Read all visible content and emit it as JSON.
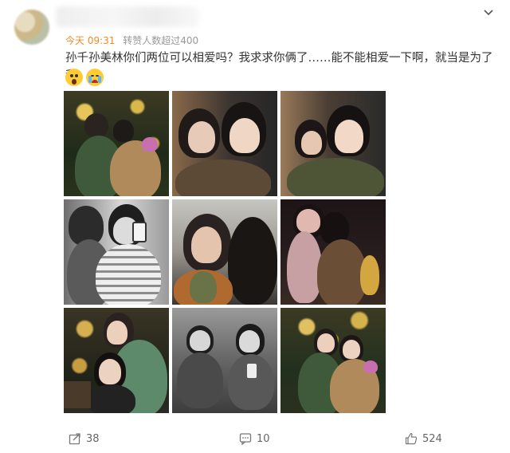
{
  "post": {
    "time": "今天 09:31",
    "repost_note": "转赞人数超过400",
    "text": "孙千孙美林你们两位可以相爱吗？我求求你俩了……能不能相爱一下啊，就当是为了我",
    "emojis": [
      "scream-emoji",
      "crying-emoji"
    ]
  },
  "photos": [
    {
      "name": "photo-1",
      "scene": "night-lights-hug"
    },
    {
      "name": "photo-2",
      "scene": "indoor-selfie"
    },
    {
      "name": "photo-3",
      "scene": "indoor-smile"
    },
    {
      "name": "photo-4",
      "scene": "bw-mirror-selfie"
    },
    {
      "name": "photo-5",
      "scene": "outdoor-selfie"
    },
    {
      "name": "photo-6",
      "scene": "dark-street"
    },
    {
      "name": "photo-7",
      "scene": "night-sit"
    },
    {
      "name": "photo-8",
      "scene": "bw-crouch"
    },
    {
      "name": "photo-9",
      "scene": "night-lights-pose"
    }
  ],
  "actions": {
    "share_count": "38",
    "comment_count": "10",
    "like_count": "524"
  },
  "colors": {
    "time_accent": "#f08a24",
    "meta_gray": "#999999",
    "text": "#333333"
  }
}
